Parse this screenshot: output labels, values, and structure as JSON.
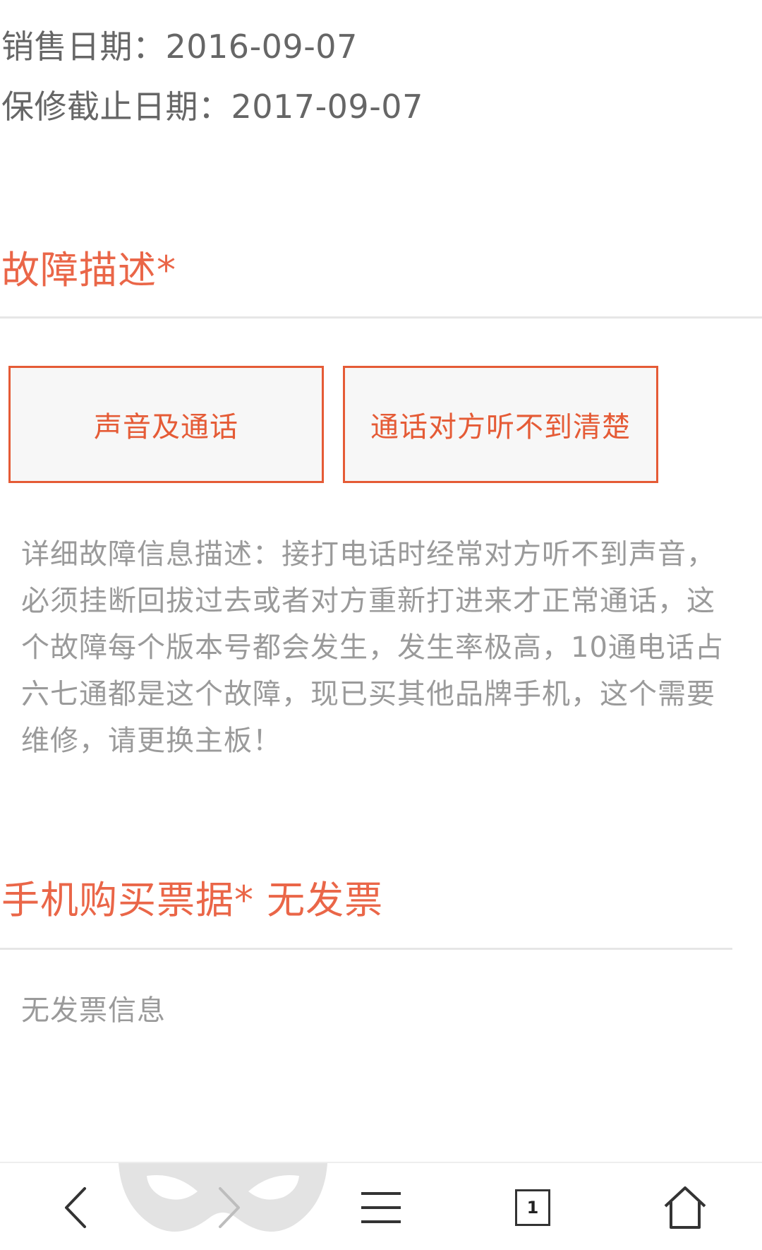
{
  "device_info": {
    "sale_date": "销售日期：2016-09-07",
    "warranty_date": "保修截止日期：2017-09-07"
  },
  "fault_section": {
    "title": "故障描述*",
    "tags": [
      "声音及通话",
      "通话对方听不到清楚"
    ],
    "detail": "详细故障信息描述：接打电话时经常对方听不到声音，必须挂断回拔过去或者对方重新打进来才正常通话，这个故障每个版本号都会发生，发生率极高，10通电话占六七通都是这个故障，现已买其他品牌手机，这个需要维修，请更换主板！"
  },
  "receipt_section": {
    "title": "手机购买票据* 无发票",
    "empty_text": "无发票信息"
  },
  "toolbar": {
    "tab_count": "1",
    "icons": [
      "back-arrow-icon",
      "forward-arrow-icon",
      "menu-icon",
      "tabs-icon",
      "home-icon"
    ]
  },
  "colors": {
    "accent": "#e55b36",
    "heading": "#ea6648",
    "muted_text": "#9a9a9a",
    "body_text": "#666666"
  }
}
